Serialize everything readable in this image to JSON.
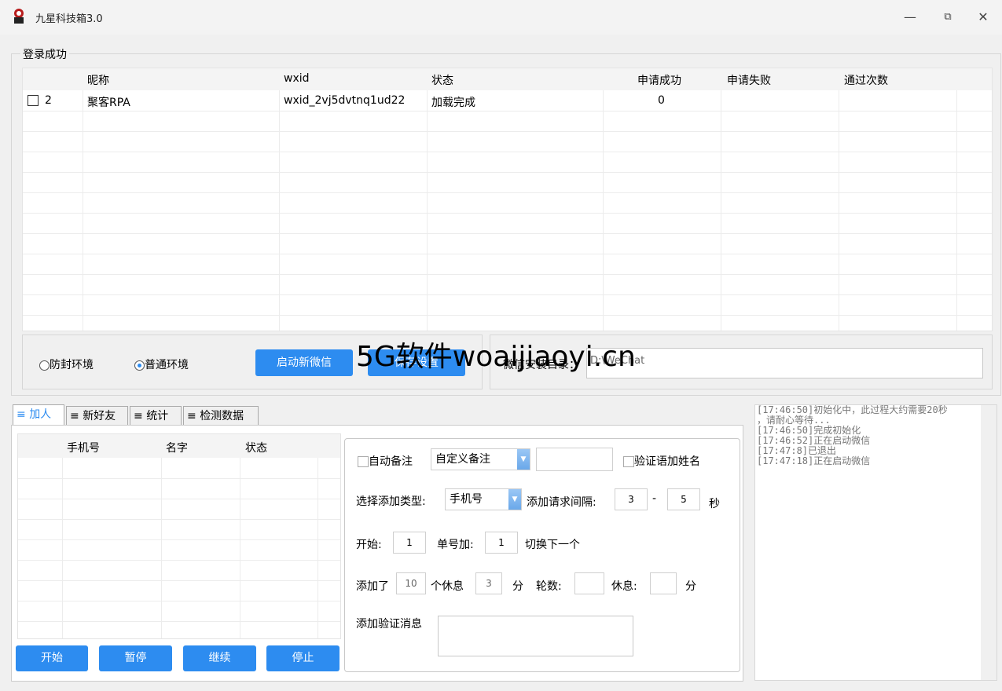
{
  "window": {
    "title": "九星科技箱3.0"
  },
  "login_group": {
    "label": "登录成功",
    "columns": [
      "昵称",
      "wxid",
      "状态",
      "申请成功",
      "申请失败",
      "通过次数"
    ],
    "rows": [
      {
        "index": "2",
        "nickname": "聚客RPA",
        "wxid": "wxid_2vj5dvtnq1ud22",
        "status": "加载完成",
        "success": "0",
        "fail": "",
        "pass": ""
      }
    ]
  },
  "env": {
    "radio_anti": "防封环境",
    "radio_normal": "普通环境",
    "selected": "普通环境"
  },
  "buttons": {
    "launch": "启动新微信",
    "save": "保存设置"
  },
  "install_dir": {
    "label": "微信安装目录：",
    "value": "D:\\WeChat"
  },
  "watermark": "5G软件woaijiaoyi.cn",
  "tabs": [
    "加人",
    "新好友",
    "统计",
    "检测数据"
  ],
  "active_tab": "加人",
  "phone_grid": {
    "columns": [
      "手机号",
      "名字",
      "状态"
    ]
  },
  "actions": {
    "start": "开始",
    "pause": "暂停",
    "resume": "继续",
    "stop": "停止"
  },
  "settings": {
    "auto_remark": "自动备注",
    "remark_select": "自定义备注",
    "remark_input": "",
    "verify_name": "验证语加姓名",
    "type_label": "选择添加类型:",
    "type_select": "手机号",
    "interval_label": "添加请求间隔:",
    "interval_min": "3",
    "dash": "-",
    "interval_max": "5",
    "sec": "秒",
    "start_label": "开始:",
    "start_value": "1",
    "add_label": "单号加:",
    "add_value": "1",
    "switch_label": "切换下一个",
    "added_label": "添加了",
    "added_value": "10",
    "rest_label": "个休息",
    "rest_value": "3",
    "min1": "分",
    "rounds_label": "轮数:",
    "rounds_value": "",
    "break_label": "休息:",
    "break_value": "",
    "min2": "分",
    "verify_msg_label": "添加验证消息",
    "verify_msg": ""
  },
  "log": [
    "[17:46:50]初始化中，此过程大约需要20秒",
    "，请耐心等待...",
    "[17:46:50]完成初始化",
    "[17:46:52]正在启动微信",
    "[17:47:8]已退出",
    "[17:47:18]正在启动微信"
  ],
  "colors": {
    "accent": "#2d8cf0"
  }
}
